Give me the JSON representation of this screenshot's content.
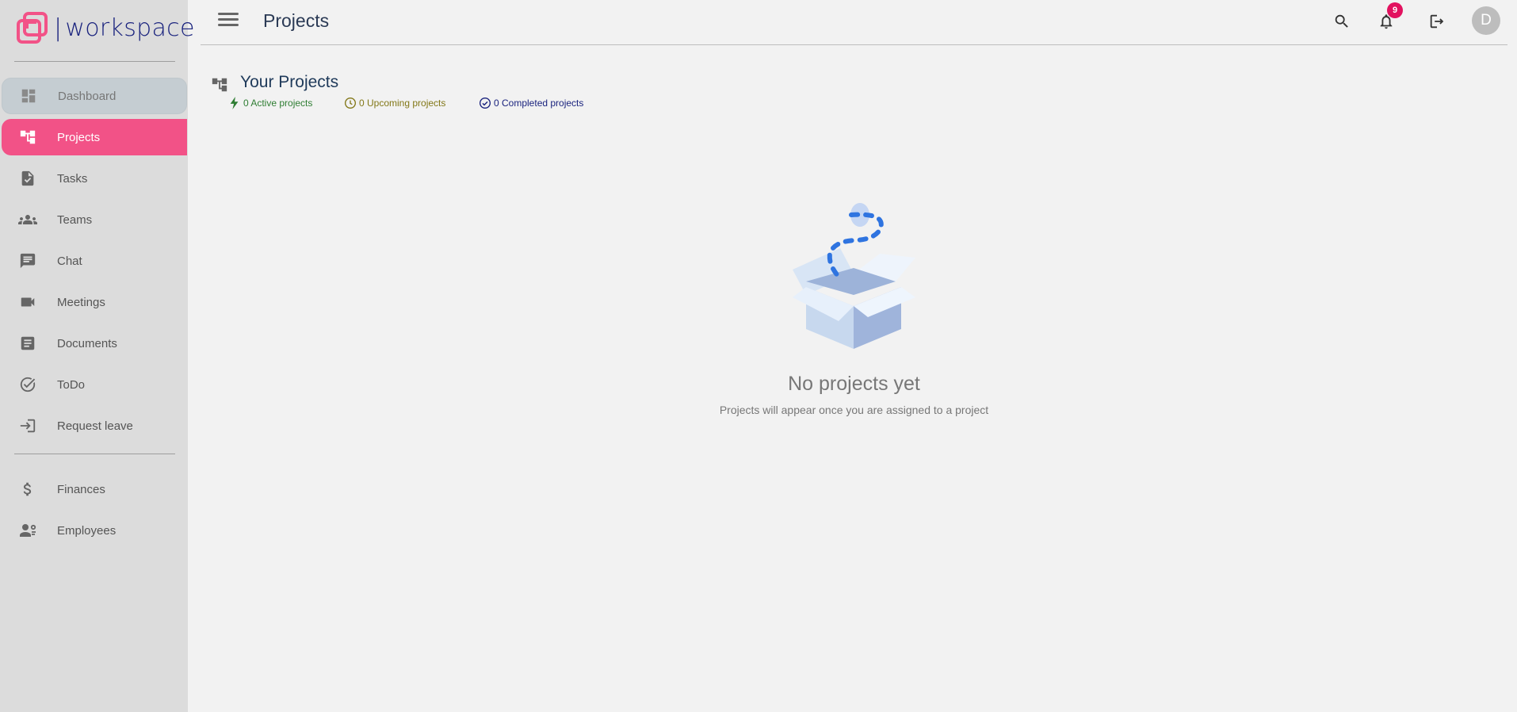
{
  "brand": {
    "name": "workspace",
    "accent": "#f25287"
  },
  "sidebar": {
    "items": [
      {
        "label": "Dashboard",
        "icon": "dashboard-icon"
      },
      {
        "label": "Projects",
        "icon": "projects-icon"
      },
      {
        "label": "Tasks",
        "icon": "task-file-icon"
      },
      {
        "label": "Teams",
        "icon": "groups-icon"
      },
      {
        "label": "Chat",
        "icon": "chat-icon"
      },
      {
        "label": "Meetings",
        "icon": "video-camera-icon"
      },
      {
        "label": "Documents",
        "icon": "document-icon"
      },
      {
        "label": "ToDo",
        "icon": "check-circle-icon"
      },
      {
        "label": "Request leave",
        "icon": "login-icon"
      }
    ],
    "secondary_items": [
      {
        "label": "Finances",
        "icon": "dollar-icon"
      },
      {
        "label": "Employees",
        "icon": "employees-icon"
      }
    ]
  },
  "header": {
    "title": "Projects",
    "notification_count": "9",
    "avatar_initial": "D"
  },
  "section": {
    "title": "Your Projects",
    "stats": {
      "active": {
        "label": "0 Active projects",
        "color": "#2e7d32"
      },
      "upcoming": {
        "label": "0 Upcoming projects",
        "color": "#827717"
      },
      "completed": {
        "label": "0 Completed projects",
        "color": "#1a237e"
      }
    }
  },
  "empty_state": {
    "title": "No projects yet",
    "subtitle": "Projects will appear once you are assigned to a project"
  }
}
